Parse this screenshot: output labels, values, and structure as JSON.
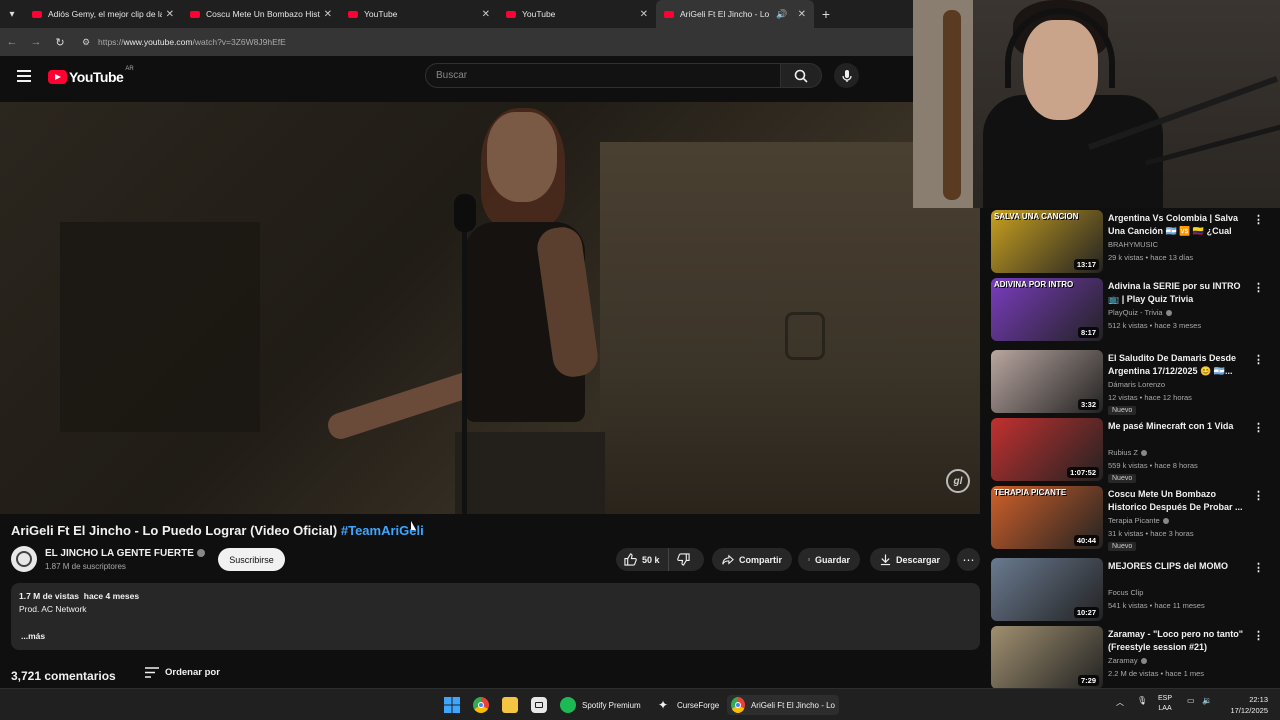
{
  "browser": {
    "tabs": [
      {
        "title": "Adiós Gemy, el mejor clip de la"
      },
      {
        "title": "Coscu Mete Un Bombazo Histo"
      },
      {
        "title": "YouTube"
      },
      {
        "title": "YouTube"
      },
      {
        "title": "AriGeli Ft El Jincho - Lo Pue"
      }
    ],
    "url_prefix": "https://",
    "url_domain": "www.youtube.com",
    "url_path": "/watch?v=3Z6W8J9hEfE"
  },
  "header": {
    "logo_text": "YouTube",
    "country_code": "AR",
    "search_placeholder": "Buscar"
  },
  "video": {
    "title": "AriGeli Ft El Jincho - Lo Puedo Lograr (Video Oficial)",
    "hashtag": "#TeamAriGeli",
    "watermark": "gl"
  },
  "channel": {
    "name": "EL JINCHO LA GENTE FUERTE",
    "subscribers": "1.87 M de suscriptores",
    "subscribe_label": "Suscribirse"
  },
  "actions": {
    "likes": "50 k",
    "share": "Compartir",
    "save": "Guardar",
    "download": "Descargar"
  },
  "description": {
    "views": "1.7 M de vistas",
    "age": "hace 4 meses",
    "line1": "Prod. AC Network",
    "more": "...más"
  },
  "comments": {
    "count": "3,721 comentarios",
    "sort": "Ordenar por"
  },
  "recommendations": [
    {
      "thumb_text": "SALVA UNA CANCION",
      "duration": "13:17",
      "title": "Argentina Vs Colombia | Salva Una Canción 🇦🇷 🆚 🇨🇴 ¿Cual Es...",
      "channel": "BRAHYMUSIC",
      "stats": "29 k vistas • hace 13 días",
      "badge": "",
      "verified": false,
      "color": "#c8a020"
    },
    {
      "thumb_text": "ADIVINA POR INTRO",
      "duration": "8:17",
      "title": "Adivina la SERIE por su INTRO 📺 | Play Quiz Trivia",
      "channel": "PlayQuiz - Trivia",
      "stats": "512 k vistas • hace 3 meses",
      "badge": "",
      "verified": true,
      "color": "#7a3cc0"
    },
    {
      "thumb_text": "",
      "duration": "3:32",
      "title": "El Saludito De Damaris Desde Argentina 17/12/2025 😊 🇦🇷...",
      "channel": "Dámaris Lorenzo",
      "stats": "12 vistas • hace 12 horas",
      "badge": "Nuevo",
      "verified": false,
      "color": "#b9a6a0"
    },
    {
      "thumb_text": "",
      "duration": "1:07:52",
      "title": "Me pasé Minecraft con 1 Vida",
      "channel": "Rubius Z",
      "stats": "559 k vistas • hace 8 horas",
      "badge": "Nuevo",
      "verified": true,
      "color": "#c23030"
    },
    {
      "thumb_text": "TERAPIA PICANTE",
      "duration": "40:44",
      "title": "Coscu Mete Un Bombazo Historico Después De Probar ...",
      "channel": "Terapia Picante",
      "stats": "31 k vistas • hace 3 horas",
      "badge": "Nuevo",
      "verified": true,
      "color": "#d0602a"
    },
    {
      "thumb_text": "",
      "duration": "10:27",
      "title": "MEJORES CLIPS del MOMO",
      "channel": "Focus Clip",
      "stats": "541 k vistas • hace 11 meses",
      "badge": "",
      "verified": false,
      "color": "#6a7a90"
    },
    {
      "thumb_text": "",
      "duration": "7:29",
      "title": "Zaramay - \"Loco pero no tanto\" (Freestyle session #21)",
      "channel": "Zaramay",
      "stats": "2.2 M de vistas • hace 1 mes",
      "badge": "",
      "verified": true,
      "color": "#a09070"
    }
  ],
  "taskbar": {
    "spotify": "Spotify Premium",
    "curseforge": "CurseForge",
    "chrome_window": "AriGeli Ft El Jincho - Lo",
    "lang1": "ESP",
    "lang2": "LAA",
    "time": "22:13",
    "date": "17/12/2025"
  },
  "colors": {
    "accent_red": "#ff0033",
    "link_blue": "#3ea6ff",
    "background": "#0f0f0f"
  }
}
